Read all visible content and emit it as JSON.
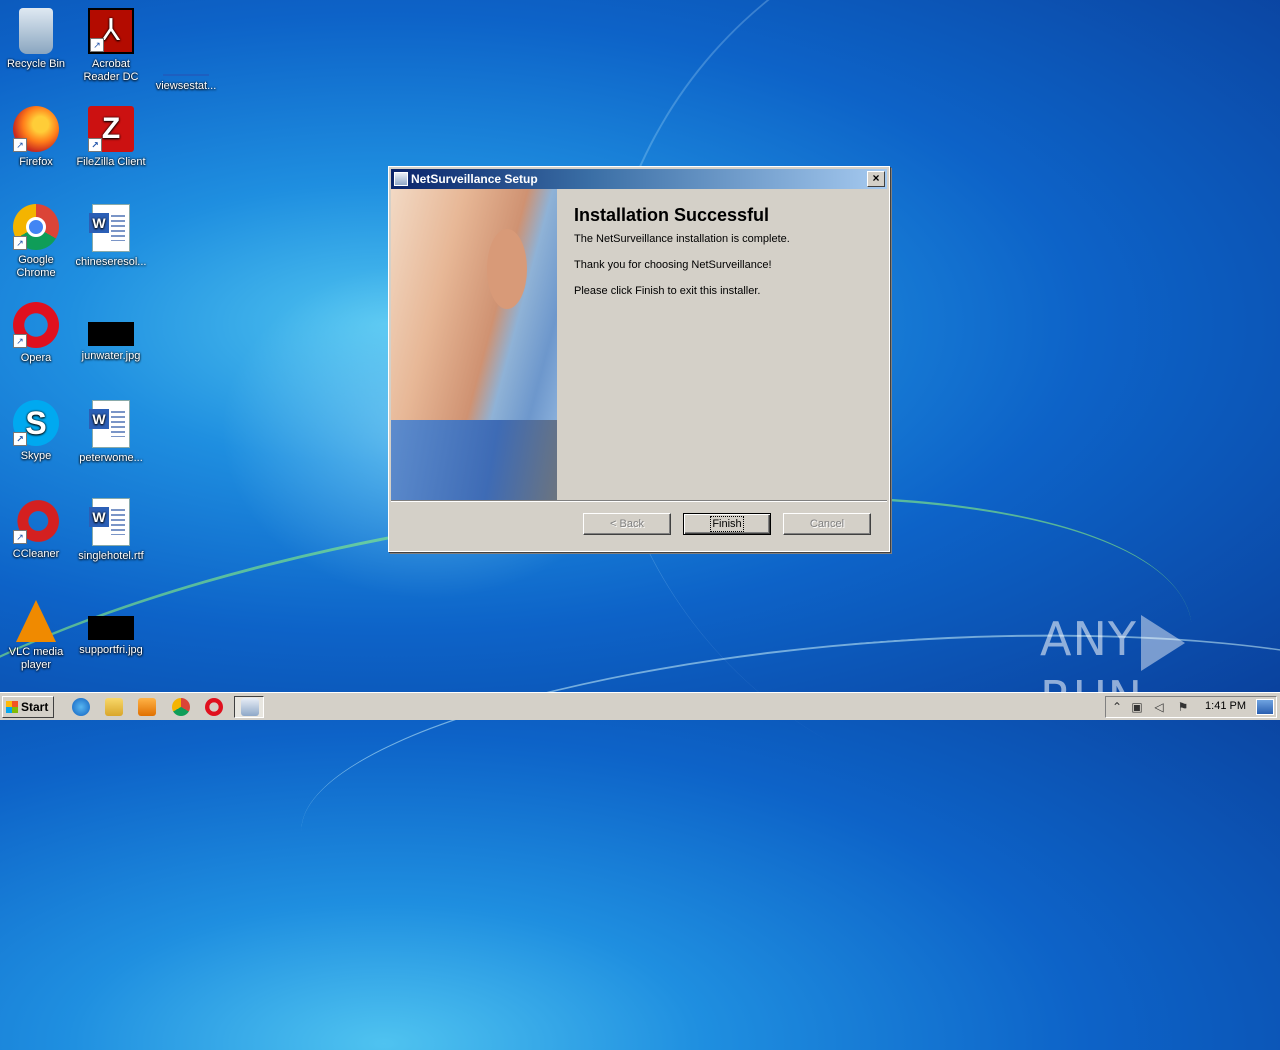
{
  "desktop": {
    "icons": [
      {
        "label": "Recycle Bin"
      },
      {
        "label": "Acrobat Reader DC"
      },
      {
        "label": "viewsestat..."
      },
      {
        "label": "Firefox"
      },
      {
        "label": "FileZilla Client"
      },
      {
        "label": "Google Chrome"
      },
      {
        "label": "chineseresol..."
      },
      {
        "label": "Opera"
      },
      {
        "label": "junwater.jpg"
      },
      {
        "label": "Skype"
      },
      {
        "label": "peterwome..."
      },
      {
        "label": "CCleaner"
      },
      {
        "label": "singlehotel.rtf"
      },
      {
        "label": "VLC media player"
      },
      {
        "label": "supportfri.jpg"
      }
    ]
  },
  "dialog": {
    "title": "NetSurveillance Setup",
    "heading": "Installation Successful",
    "line1": "The NetSurveillance  installation is complete.",
    "line2": "Thank you for choosing NetSurveillance!",
    "line3": "Please click Finish to exit this installer.",
    "back_label": "< Back",
    "finish_label": "Finish",
    "cancel_label": "Cancel",
    "close_glyph": "×"
  },
  "watermark": {
    "left": "ANY",
    "right": "RUN"
  },
  "taskbar": {
    "start_label": "Start",
    "clock": "1:41 PM"
  },
  "icons": {
    "recycle": "recycle-bin-icon",
    "acrobat": "acrobat-icon",
    "firefox": "firefox-icon",
    "filezilla": "filezilla-icon",
    "chrome": "chrome-icon",
    "word": "word-document-icon",
    "opera": "opera-icon",
    "image": "image-file-icon",
    "skype": "skype-icon",
    "ccleaner": "ccleaner-icon",
    "vlc": "vlc-icon"
  }
}
